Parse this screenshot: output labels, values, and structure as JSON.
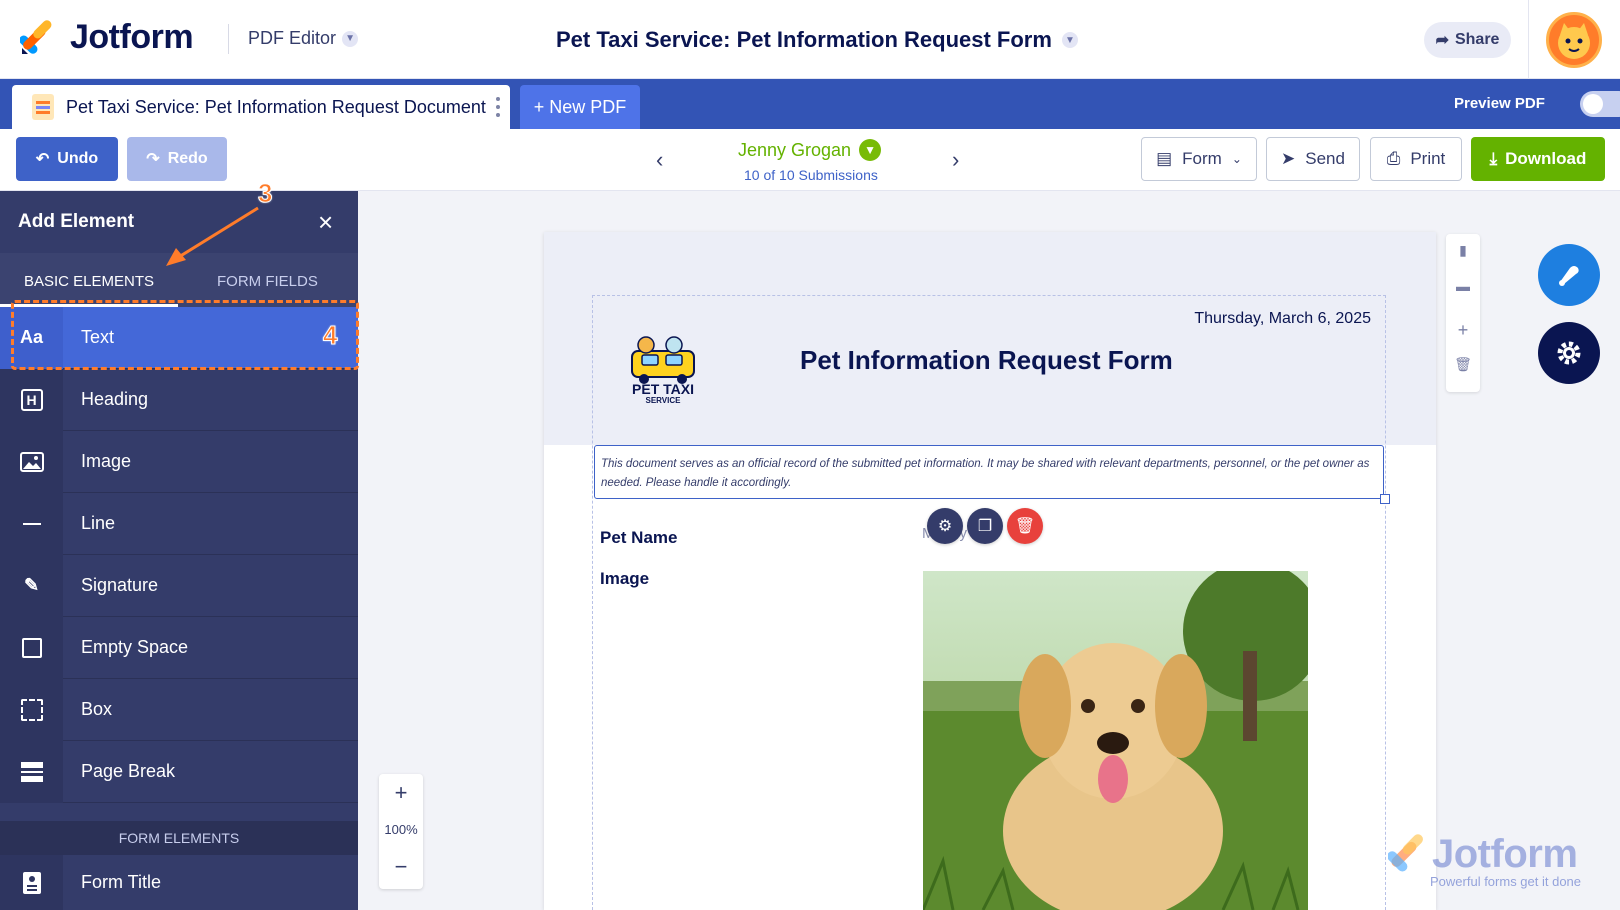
{
  "header": {
    "brand": "Jotform",
    "app_name": "PDF Editor",
    "form_title": "Pet Taxi Service: Pet Information Request Form",
    "share_label": "Share"
  },
  "tabs": {
    "document_tab": "Pet Taxi Service: Pet Information Request Document",
    "new_pdf": "+ New PDF",
    "preview_pdf": "Preview PDF"
  },
  "toolbar": {
    "undo": "Undo",
    "redo": "Redo",
    "submitter_name": "Jenny Grogan",
    "submission_count": "10 of 10 Submissions",
    "form": "Form",
    "send": "Send",
    "print": "Print",
    "download": "Download"
  },
  "sidebar": {
    "title": "Add Element",
    "tab_basic": "BASIC ELEMENTS",
    "tab_fields": "FORM FIELDS",
    "items": [
      {
        "label": "Text",
        "icon": "Aa"
      },
      {
        "label": "Heading",
        "icon": "H"
      },
      {
        "label": "Image",
        "icon": "image-icon"
      },
      {
        "label": "Line",
        "icon": "line-icon"
      },
      {
        "label": "Signature",
        "icon": "pen-icon"
      },
      {
        "label": "Empty Space",
        "icon": "square-icon"
      },
      {
        "label": "Box",
        "icon": "box-icon"
      },
      {
        "label": "Page Break",
        "icon": "page-break-icon"
      }
    ],
    "form_elements_header": "FORM ELEMENTS",
    "form_items": [
      {
        "label": "Form Title",
        "icon": "form-title-icon"
      }
    ]
  },
  "annotations": {
    "step_3": "3",
    "step_4": "4"
  },
  "zoom": {
    "plus": "+",
    "value": "100%",
    "minus": "−"
  },
  "document": {
    "date": "Thursday, March 6, 2025",
    "heading": "Pet Information Request Form",
    "logo_text_1": "PET TAXI",
    "logo_text_2": "SERVICE",
    "notice": "This document serves as an official record of the submitted pet information. It may be shared with relevant departments, personnel, or the pet owner as needed. Please handle it accordingly.",
    "fields": [
      {
        "label": "Pet Name",
        "value": "Marley"
      },
      {
        "label": "Image",
        "value": ""
      }
    ]
  },
  "watermark": {
    "brand": "Jotform",
    "tagline": "Powerful forms get it done"
  },
  "colors": {
    "primary_blue": "#3354b5",
    "accent_blue": "#4468d8",
    "sidebar_bg": "#343c6a",
    "download_green": "#64b200",
    "annotation_orange": "#ff7c2a"
  }
}
